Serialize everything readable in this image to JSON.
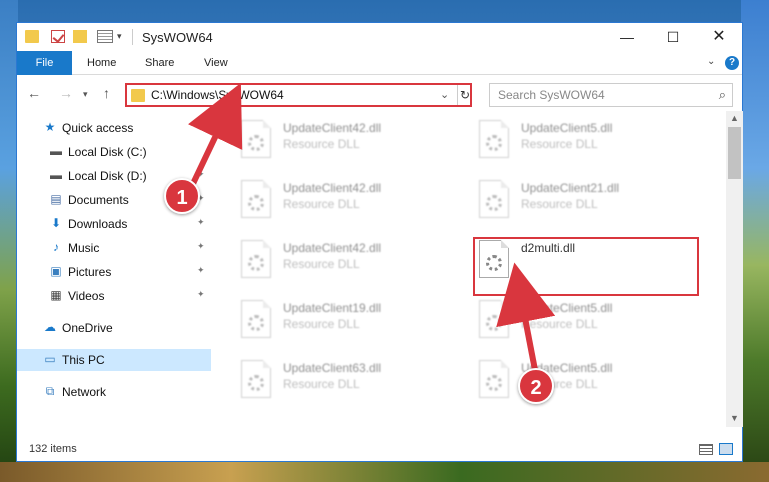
{
  "window": {
    "title": "SysWOW64",
    "minimize": "—",
    "maximize": "☐",
    "close": "✕"
  },
  "ribbon": {
    "tabs": [
      "File",
      "Home",
      "Share",
      "View"
    ],
    "collapse": "⌄",
    "help": "?"
  },
  "navbar": {
    "back": "←",
    "forward": "→",
    "recent": "▾",
    "up": "↑",
    "address": "C:\\Windows\\SysWOW64",
    "address_dropdown": "⌄",
    "refresh": "↻",
    "search_placeholder": "Search SysWOW64",
    "search_icon": "⌕"
  },
  "sidebar": {
    "items": [
      {
        "label": "Quick access",
        "icon": "star-icon",
        "glyph": "★",
        "color": "#1979ca",
        "pinned": false
      },
      {
        "label": "Local Disk (C:)",
        "icon": "drive-icon",
        "glyph": "▬",
        "color": "#555555",
        "pinned": false
      },
      {
        "label": "Local Disk (D:)",
        "icon": "drive-icon",
        "glyph": "▬",
        "color": "#555555",
        "pinned": true
      },
      {
        "label": "Documents",
        "icon": "document-icon",
        "glyph": "▤",
        "color": "#4a6fa5",
        "pinned": true
      },
      {
        "label": "Downloads",
        "icon": "download-icon",
        "glyph": "⬇",
        "color": "#1979ca",
        "pinned": true
      },
      {
        "label": "Music",
        "icon": "music-icon",
        "glyph": "♪",
        "color": "#1979ca",
        "pinned": true
      },
      {
        "label": "Pictures",
        "icon": "pictures-icon",
        "glyph": "▣",
        "color": "#3a7fbf",
        "pinned": true
      },
      {
        "label": "Videos",
        "icon": "video-icon",
        "glyph": "▦",
        "color": "#444444",
        "pinned": true
      },
      {
        "label": "OneDrive",
        "icon": "cloud-icon",
        "glyph": "☁",
        "color": "#1979ca",
        "pinned": false
      },
      {
        "label": "This PC",
        "icon": "computer-icon",
        "glyph": "▭",
        "color": "#3a7fbf",
        "pinned": false,
        "selected": true
      },
      {
        "label": "Network",
        "icon": "network-icon",
        "glyph": "⧉",
        "color": "#3a7fbf",
        "pinned": false
      }
    ],
    "pin_glyph": "📌"
  },
  "files": [
    {
      "name": "UpdateClient42.dll",
      "type": "Resource DLL",
      "blurred": true
    },
    {
      "name": "UpdateClient5.dll",
      "type": "Resource DLL",
      "blurred": true
    },
    {
      "name": "UpdateClient42.dll",
      "type": "Resource DLL",
      "blurred": true
    },
    {
      "name": "UpdateClient21.dll",
      "type": "Resource DLL",
      "blurred": true
    },
    {
      "name": "UpdateClient42.dll",
      "type": "Resource DLL",
      "blurred": true
    },
    {
      "name": "d2multi.dll",
      "type": "",
      "blurred": false,
      "highlighted": true
    },
    {
      "name": "UpdateClient19.dll",
      "type": "Resource DLL",
      "blurred": true
    },
    {
      "name": "UpdateClient5.dll",
      "type": "Resource DLL",
      "blurred": true
    },
    {
      "name": "UpdateClient63.dll",
      "type": "Resource DLL",
      "blurred": true
    },
    {
      "name": "UpdateClient5.dll",
      "type": "Resource DLL",
      "blurred": true
    }
  ],
  "status": {
    "item_count": "132 items"
  },
  "callouts": [
    "1",
    "2"
  ],
  "colors": {
    "accent": "#1979ca",
    "highlight_red": "#d9363e",
    "selected_bg": "#cce8ff"
  }
}
